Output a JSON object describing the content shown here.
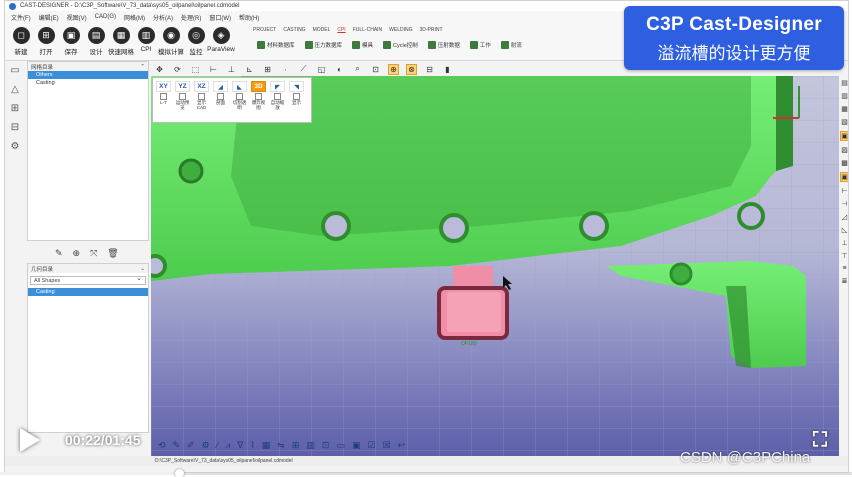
{
  "window": {
    "title": "CAST-DESIGNER - D:\\C3P_Software\\V_73_data\\sys05_oilpanel\\oilpanel.cdmodel"
  },
  "menu": [
    {
      "label": "文件(F)"
    },
    {
      "label": "编辑(E)"
    },
    {
      "label": "视图(V)"
    },
    {
      "label": "CAD(G)"
    },
    {
      "label": "网格(M)"
    },
    {
      "label": "分析(A)"
    },
    {
      "label": "处理(R)"
    },
    {
      "label": "窗口(W)"
    },
    {
      "label": "帮助(H)"
    }
  ],
  "ribbon": {
    "buttons": [
      {
        "label": "新建",
        "icon": "new-file-icon",
        "glyph": "◻"
      },
      {
        "label": "打开",
        "icon": "folder-open-icon",
        "glyph": "⊞"
      },
      {
        "label": "保存",
        "icon": "save-icon",
        "glyph": "▣"
      },
      {
        "label": "设计",
        "icon": "design-icon",
        "glyph": "▤"
      },
      {
        "label": "快速网格",
        "icon": "mesh-icon",
        "glyph": "▦"
      },
      {
        "label": "CPI",
        "icon": "cpi-icon",
        "glyph": "▥"
      },
      {
        "label": "模拟计算",
        "icon": "simulate-icon",
        "glyph": "◉"
      },
      {
        "label": "监控",
        "icon": "monitor-icon",
        "glyph": "◎"
      },
      {
        "label": "ParaView",
        "icon": "paraview-icon",
        "glyph": "◈"
      }
    ],
    "tabs": [
      {
        "label": "PROJECT"
      },
      {
        "label": "CASTING"
      },
      {
        "label": "MODEL"
      },
      {
        "label": "CPI"
      },
      {
        "label": "FULL-CHAIN"
      },
      {
        "label": "WELDING"
      },
      {
        "label": "3D-PRINT"
      }
    ],
    "active_tab": "CPI",
    "row_items": [
      {
        "label": "材料数据库"
      },
      {
        "label": "压力数据库"
      },
      {
        "label": "模具"
      },
      {
        "label": "Cycle控制"
      },
      {
        "label": "压射数据"
      },
      {
        "label": "工作"
      },
      {
        "label": "射流"
      }
    ]
  },
  "left_panel": {
    "tree_header": "网格目录",
    "tree_items": [
      {
        "label": "Others"
      },
      {
        "label": "Casting"
      }
    ],
    "geometry_header": "几何目录",
    "filter_value": "All Shapes",
    "geometry_items": [
      {
        "label": "Casting"
      }
    ]
  },
  "view_panel": {
    "views": [
      {
        "label": "XY",
        "active": false
      },
      {
        "label": "YZ",
        "active": false
      },
      {
        "label": "XZ",
        "active": false
      },
      {
        "label": "◢",
        "active": false
      },
      {
        "label": "◣",
        "active": false
      },
      {
        "label": "3D",
        "active": true
      },
      {
        "label": "◤",
        "active": false
      },
      {
        "label": "◥",
        "active": false
      }
    ],
    "labels": [
      {
        "label": "L-T"
      },
      {
        "label": "运动预览"
      },
      {
        "label": "显示CAD"
      },
      {
        "label": "剖面"
      },
      {
        "label": "切割透明"
      },
      {
        "label": "爆炸视图"
      },
      {
        "label": "自动缩放"
      },
      {
        "label": "显示"
      }
    ]
  },
  "viewport": {
    "model_label": "OF1(6)",
    "colors": {
      "casting": "#62e662",
      "overflow": "#f08ea8",
      "overflow_edge": "#7a2a3f",
      "background_top": "#c4c6dd",
      "background_bottom": "#5a5ca8"
    }
  },
  "status_bar": {
    "path": "D:\\C3P_Software\\V_73_data\\sys05_oilpanel\\oilpanel.cdmodel"
  },
  "video": {
    "time": "00:22/01:45",
    "progress_pct": 21,
    "watermark": "CSDN @C3PChina"
  },
  "promo": {
    "title": "C3P Cast-Designer",
    "subtitle": "溢流槽的设计更方便"
  }
}
